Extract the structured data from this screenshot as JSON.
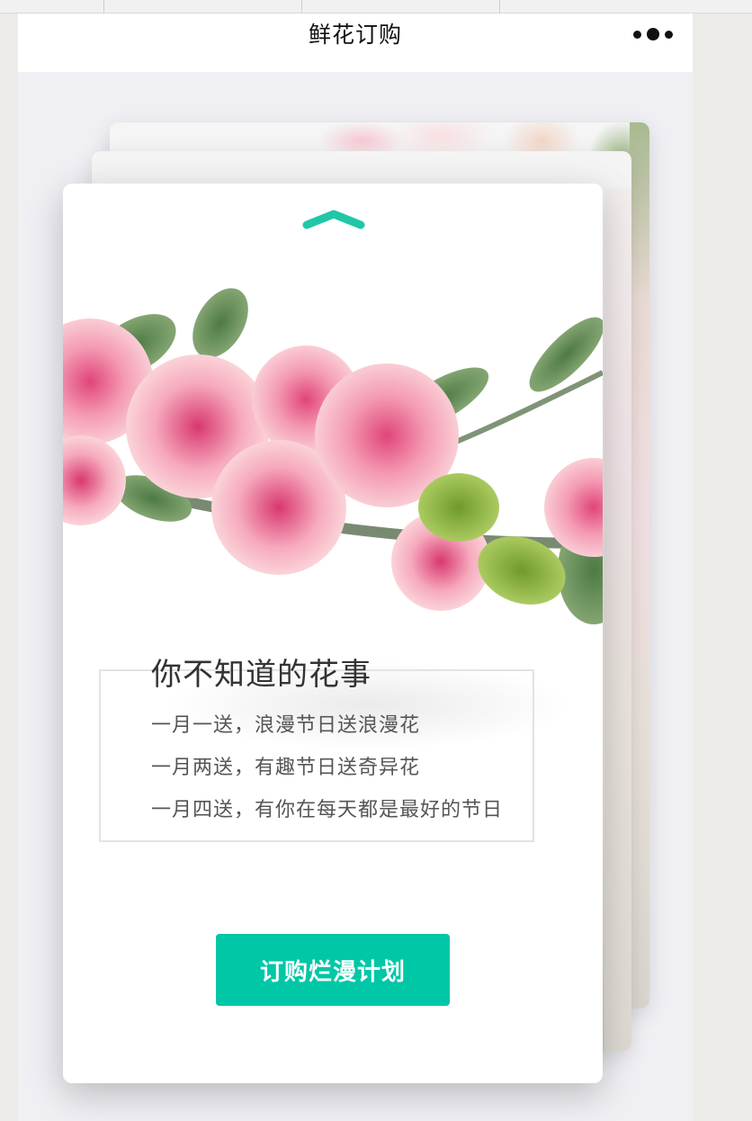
{
  "nav": {
    "title": "鲜花订购",
    "more_icon": "more-dots-icon"
  },
  "card": {
    "up_icon": "chevron-up-icon",
    "title": "你不知道的花事",
    "lines": [
      "一月一送，浪漫节日送浪漫花",
      "一月两送，有趣节日送奇异花",
      "一月四送，有你在每天都是最好的节日"
    ],
    "button_label": "订购烂漫计划"
  },
  "colors": {
    "accent": "#00c7a6",
    "page_bg": "#efeff4",
    "title_text": "#333333",
    "body_text": "#555555"
  }
}
